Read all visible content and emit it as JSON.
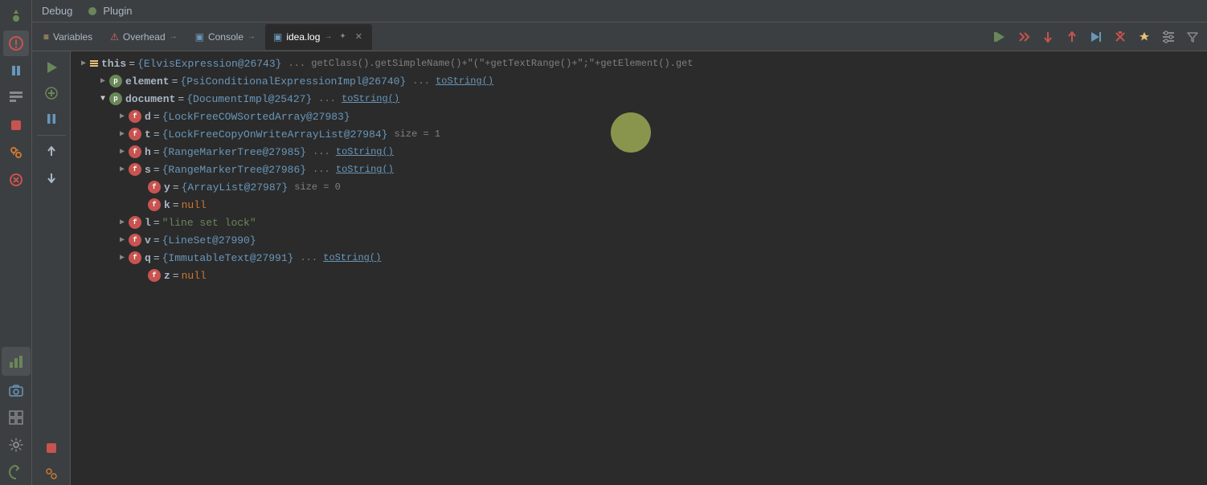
{
  "menu": {
    "debug_label": "Debug",
    "plugin_label": "Plugin"
  },
  "tabs": [
    {
      "id": "variables",
      "label": "Variables",
      "icon": "≡",
      "active": false,
      "has_arrow": false,
      "has_close": false
    },
    {
      "id": "overhead",
      "label": "Overhead",
      "icon": "⚠",
      "active": false,
      "has_arrow": true,
      "has_close": false
    },
    {
      "id": "console",
      "label": "Console",
      "icon": "▣",
      "active": false,
      "has_arrow": true,
      "has_close": false
    },
    {
      "id": "idea_log",
      "label": "idea.log",
      "icon": "▣",
      "active": true,
      "has_arrow": true,
      "has_close": true
    }
  ],
  "variables": [
    {
      "indent": 1,
      "expand": true,
      "type": "this_bar",
      "name": "this",
      "eq": "=",
      "value": "{ElvisExpression@26743}",
      "meta": "... getClass().getSimpleName()+\"(\"+getTextRange()+\";\"+getElement().get"
    },
    {
      "indent": 2,
      "expand": true,
      "type": "p",
      "name": "element",
      "eq": "=",
      "value": "{PsiConditionalExpressionImpl@26740}",
      "meta": "... toString()"
    },
    {
      "indent": 2,
      "expand": false,
      "type": "p",
      "name": "document",
      "eq": "=",
      "value": "{DocumentImpl@25427}",
      "meta": "... toString()"
    },
    {
      "indent": 3,
      "expand": true,
      "type": "f",
      "name": "d",
      "eq": "=",
      "value": "{LockFreeCOWSortedArray@27983}",
      "meta": ""
    },
    {
      "indent": 3,
      "expand": true,
      "type": "f",
      "name": "t",
      "eq": "=",
      "value": "{LockFreeCopyOnWriteArrayList@27984}",
      "meta": "size = 1"
    },
    {
      "indent": 3,
      "expand": true,
      "type": "f",
      "name": "h",
      "eq": "=",
      "value": "{RangeMarkerTree@27985}",
      "meta": "... toString()"
    },
    {
      "indent": 3,
      "expand": true,
      "type": "f",
      "name": "s",
      "eq": "=",
      "value": "{RangeMarkerTree@27986}",
      "meta": "... toString()"
    },
    {
      "indent": 3,
      "expand": false,
      "type": "f",
      "name": "y",
      "eq": "=",
      "value": "{ArrayList@27987}",
      "meta": "size = 0"
    },
    {
      "indent": 3,
      "expand": false,
      "type": "f",
      "name": "k",
      "eq": "=",
      "value": "null",
      "meta": ""
    },
    {
      "indent": 3,
      "expand": true,
      "type": "f",
      "name": "l",
      "eq": "=",
      "value": "\"line set lock\"",
      "meta": ""
    },
    {
      "indent": 3,
      "expand": true,
      "type": "f",
      "name": "v",
      "eq": "=",
      "value": "{LineSet@27990}",
      "meta": ""
    },
    {
      "indent": 3,
      "expand": true,
      "type": "f",
      "name": "q",
      "eq": "=",
      "value": "{ImmutableText@27991}",
      "meta": "... toString()"
    },
    {
      "indent": 3,
      "expand": false,
      "type": "f",
      "name": "z",
      "eq": "=",
      "value": "null",
      "meta": ""
    }
  ],
  "toolbar": {
    "btn1": "▶",
    "btn2": "⬇",
    "btn3": "⬇",
    "btn4": "⬇",
    "btn5": "↗",
    "btn6": "✖",
    "btn7": "↕",
    "btn8": "▦"
  }
}
